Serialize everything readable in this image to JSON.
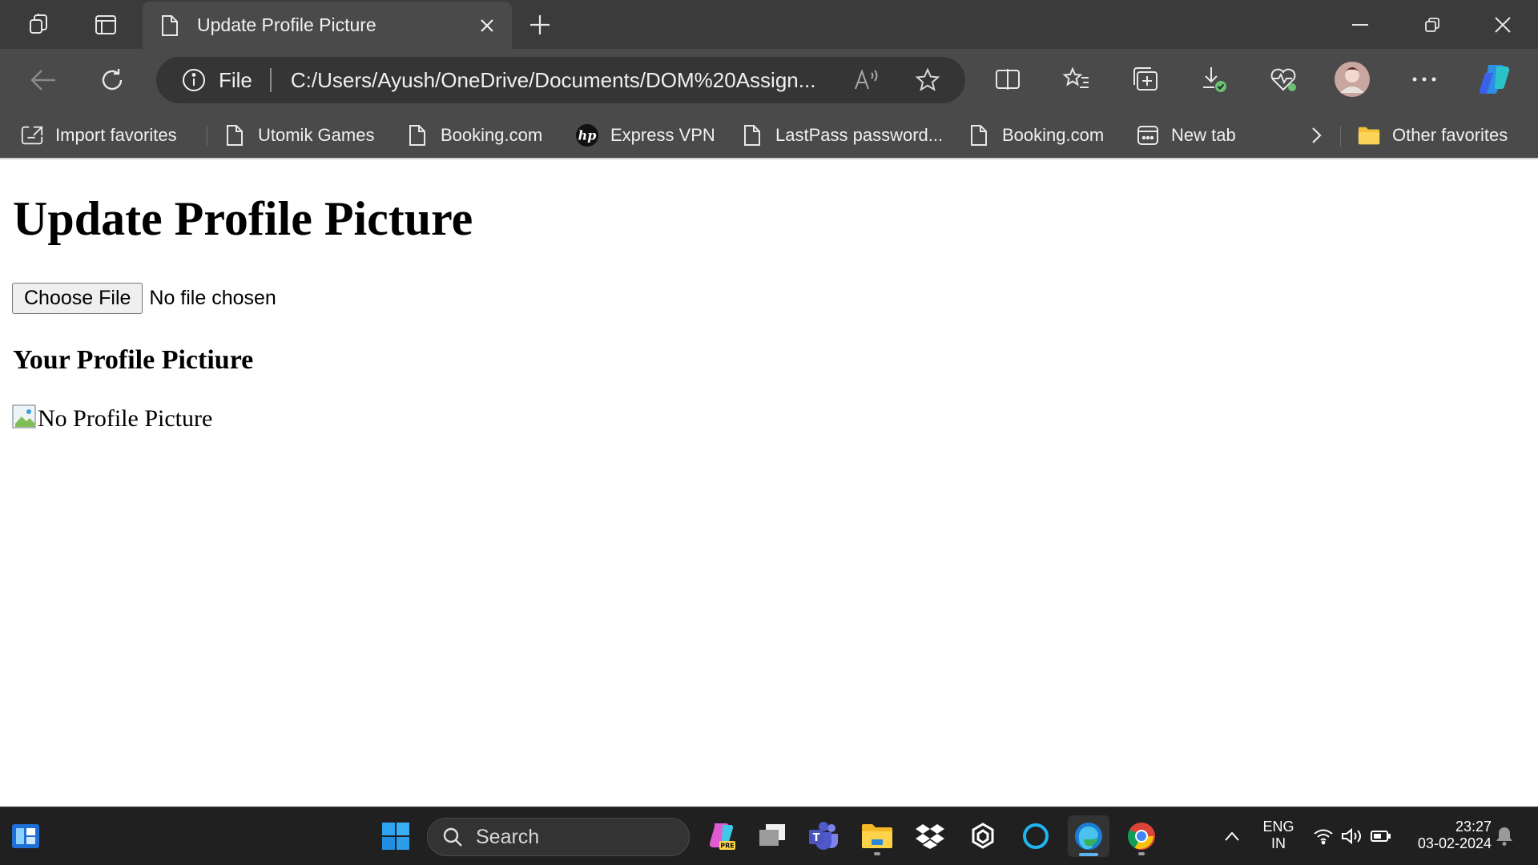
{
  "tab": {
    "title": "Update Profile Picture"
  },
  "address_bar": {
    "scheme": "File",
    "url": "C:/Users/Ayush/OneDrive/Documents/DOM%20Assign..."
  },
  "favorites": [
    {
      "label": "Import favorites",
      "icon": "import-favorites-icon"
    },
    {
      "label": "Utomik Games",
      "icon": "page-icon"
    },
    {
      "label": "Booking.com",
      "icon": "page-icon"
    },
    {
      "label": "Express VPN",
      "icon": "hp-icon"
    },
    {
      "label": "LastPass password...",
      "icon": "page-icon"
    },
    {
      "label": "Booking.com",
      "icon": "page-icon"
    },
    {
      "label": "New tab",
      "icon": "new-tab-icon"
    }
  ],
  "other_favorites": "Other favorites",
  "page": {
    "heading": "Update Profile Picture",
    "choose_file_label": "Choose File",
    "file_status": "No file chosen",
    "subheading": "Your Profile Pictiure",
    "image_alt": "No Profile Picture"
  },
  "taskbar": {
    "search_label": "Search",
    "lang_line1": "ENG",
    "lang_line2": "IN",
    "time": "23:27",
    "date": "03-02-2024"
  },
  "colors": {
    "titlebar": "#3b3b3b",
    "toolbar": "#4a4a4a",
    "omnibox": "#353535",
    "taskbar": "#202020",
    "accent": "#5fb2f2"
  }
}
